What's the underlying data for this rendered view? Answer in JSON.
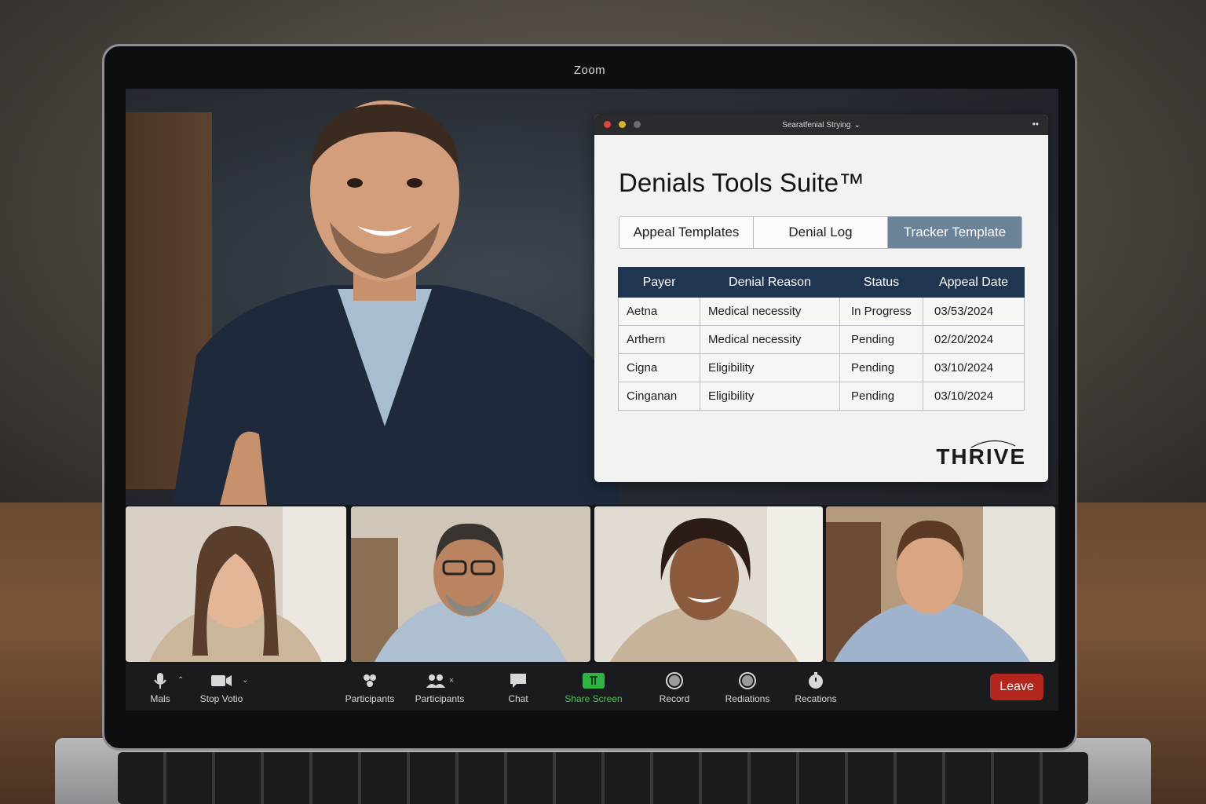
{
  "app": {
    "title": "Zoom"
  },
  "shared_window": {
    "title": "Searatfenial Strying",
    "doc_title": "Denials Tools Suite™",
    "tabs": [
      {
        "label": "Appeal Templates",
        "active": false
      },
      {
        "label": "Denial Log",
        "active": false
      },
      {
        "label": "Tracker Template",
        "active": true
      }
    ],
    "table": {
      "headers": [
        "Payer",
        "Denial Reason",
        "Status",
        "Appeal Date"
      ],
      "rows": [
        [
          "Aetna",
          "Medical necessity",
          "In Progress",
          "03/53/2024"
        ],
        [
          "Arthern",
          "Medical necessity",
          "Pending",
          "02/20/2024"
        ],
        [
          "Cigna",
          "Eligibility",
          "Pending",
          "03/10/2024"
        ],
        [
          "Cinganan",
          "Eligibility",
          "Pending",
          "03/10/2024"
        ]
      ]
    },
    "brand": "THRIVE"
  },
  "toolbar": {
    "mute_label": "Mals",
    "video_label": "Stop Votio",
    "participants_label": "Participants",
    "participants2_label": "Participants",
    "chat_label": "Chat",
    "share_label": "Share Screen",
    "record_label": "Record",
    "reactions_label": "Rediations",
    "recordings_label": "Recations",
    "leave_label": "Leave"
  },
  "colors": {
    "accent_tab": "#6a8399",
    "table_header": "#1f3550",
    "share_green": "#4fc35a",
    "leave_red": "#b3261e"
  }
}
